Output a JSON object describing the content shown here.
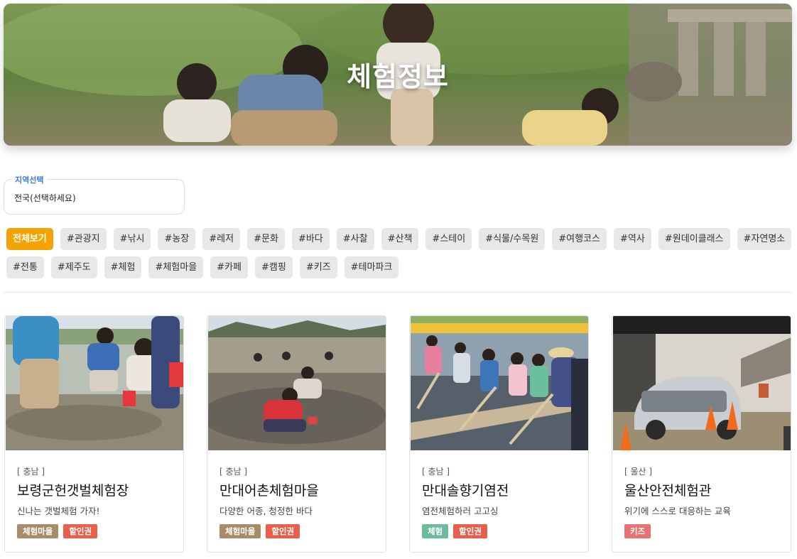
{
  "hero": {
    "title": "체험정보"
  },
  "region_select": {
    "label": "지역선택",
    "value": "전국(선택하세요)"
  },
  "tags": {
    "row1": [
      "전체보기",
      "#관광지",
      "#낚시",
      "#농장",
      "#레저",
      "#문화",
      "#바다",
      "#사찰",
      "#산책",
      "#스테이",
      "#식물/수목원",
      "#여행코스",
      "#역사",
      "#원데이클래스",
      "#자연명소"
    ],
    "row2": [
      "#전통",
      "#제주도",
      "#체험",
      "#체험마을",
      "#카페",
      "#캠핑",
      "#키즈",
      "#테마파크"
    ],
    "active": "전체보기"
  },
  "cards": [
    {
      "region": "[ 충남 ]",
      "title": "보령군헌갯벌체험장",
      "desc": "신나는 갯벌체험 가자!",
      "badges": [
        "체험마을",
        "할인권"
      ]
    },
    {
      "region": "[ 충남 ]",
      "title": "만대어촌체험마을",
      "desc": "다양한 어종, 청정한 바다",
      "badges": [
        "체험마을",
        "할인권"
      ]
    },
    {
      "region": "[ 충남 ]",
      "title": "만대솔향기염전",
      "desc": "염전체험하러 고고싱",
      "badges": [
        "체험",
        "할인권"
      ]
    },
    {
      "region": "[ 울산 ]",
      "title": "울산안전체험관",
      "desc": "위기에 스스로 대응하는 교육",
      "badges": [
        "키즈"
      ]
    }
  ],
  "badge_colors": {
    "체험마을": "#a88c6a",
    "할인권": "#e8604c",
    "체험": "#6dbb9c",
    "키즈": "#e57373"
  },
  "colors": {
    "accent": "#f5a300",
    "region_label": "#3a7bd5"
  }
}
